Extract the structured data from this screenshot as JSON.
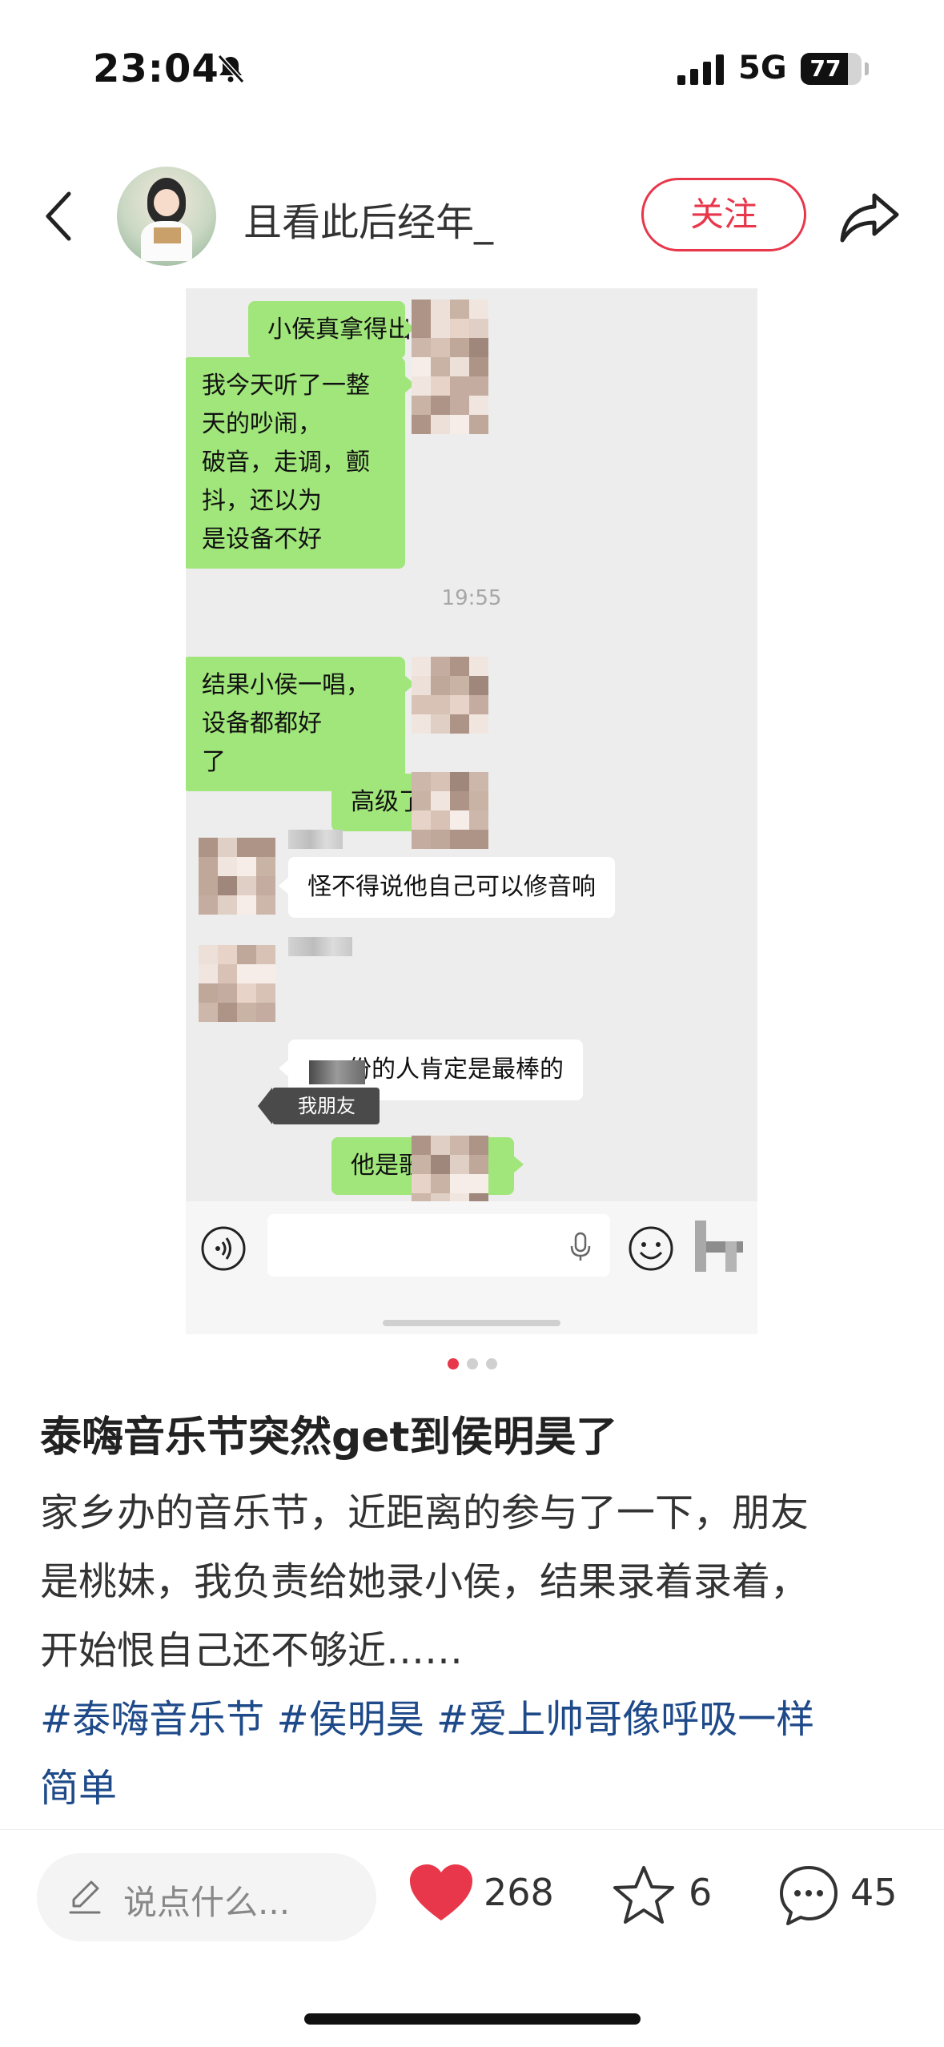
{
  "status_bar": {
    "time": "23:04",
    "network": "5G",
    "battery": "77",
    "battery_level": 0.77,
    "icons": [
      "bell-slash-icon",
      "signal-icon",
      "battery-icon"
    ]
  },
  "header": {
    "username": "且看此后经年_",
    "follow_label": "关注",
    "icons": [
      "chevron-left-icon",
      "avatar",
      "share-icon"
    ]
  },
  "chat": {
    "messages": [
      {
        "side": "right",
        "text": "小侯真拿得出手啊"
      },
      {
        "side": "right",
        "text": "我今天听了一整天的吵闹，破音，走调，颤抖，还以为是设备不好"
      },
      {
        "side": "right",
        "text": "结果小侯一唱，设备都都好了"
      },
      {
        "side": "right",
        "text": "高级了"
      },
      {
        "side": "left",
        "text": "怪不得说他自己可以修音响"
      },
      {
        "side": "left",
        "text": "份的人肯定是最棒的"
      },
      {
        "side": "right",
        "text": "他是歌手吗？"
      }
    ],
    "lines": {
      "m2": [
        "我今天听了一整天的吵闹，",
        "破音，走调，颤抖，还以为",
        "是设备不好"
      ],
      "m3": [
        "结果小侯一唱，设备都都好",
        "了"
      ]
    },
    "timestamp": "19:55",
    "tag_label": "我朋友",
    "bubble_color": "#a0e67a"
  },
  "pagination": {
    "total": 3,
    "active": 1
  },
  "post": {
    "title": "泰嗨音乐节突然get到侯明昊了",
    "body_lines": [
      "家乡办的音乐节，近距离的参与了一下，朋友",
      "是桃妹，我负责给她录小侯，结果录着录着，",
      "开始恨自己还不够近……"
    ],
    "hashtags": [
      "#泰嗨音乐节",
      "#侯明昊",
      "#爱上帅哥像呼吸一样",
      "简单"
    ],
    "hashtag_color": "#1f4a8a"
  },
  "bottom_bar": {
    "comment_placeholder": "说点什么...",
    "likes": "268",
    "stars": "6",
    "comments": "45",
    "like_color": "#e8364a"
  }
}
